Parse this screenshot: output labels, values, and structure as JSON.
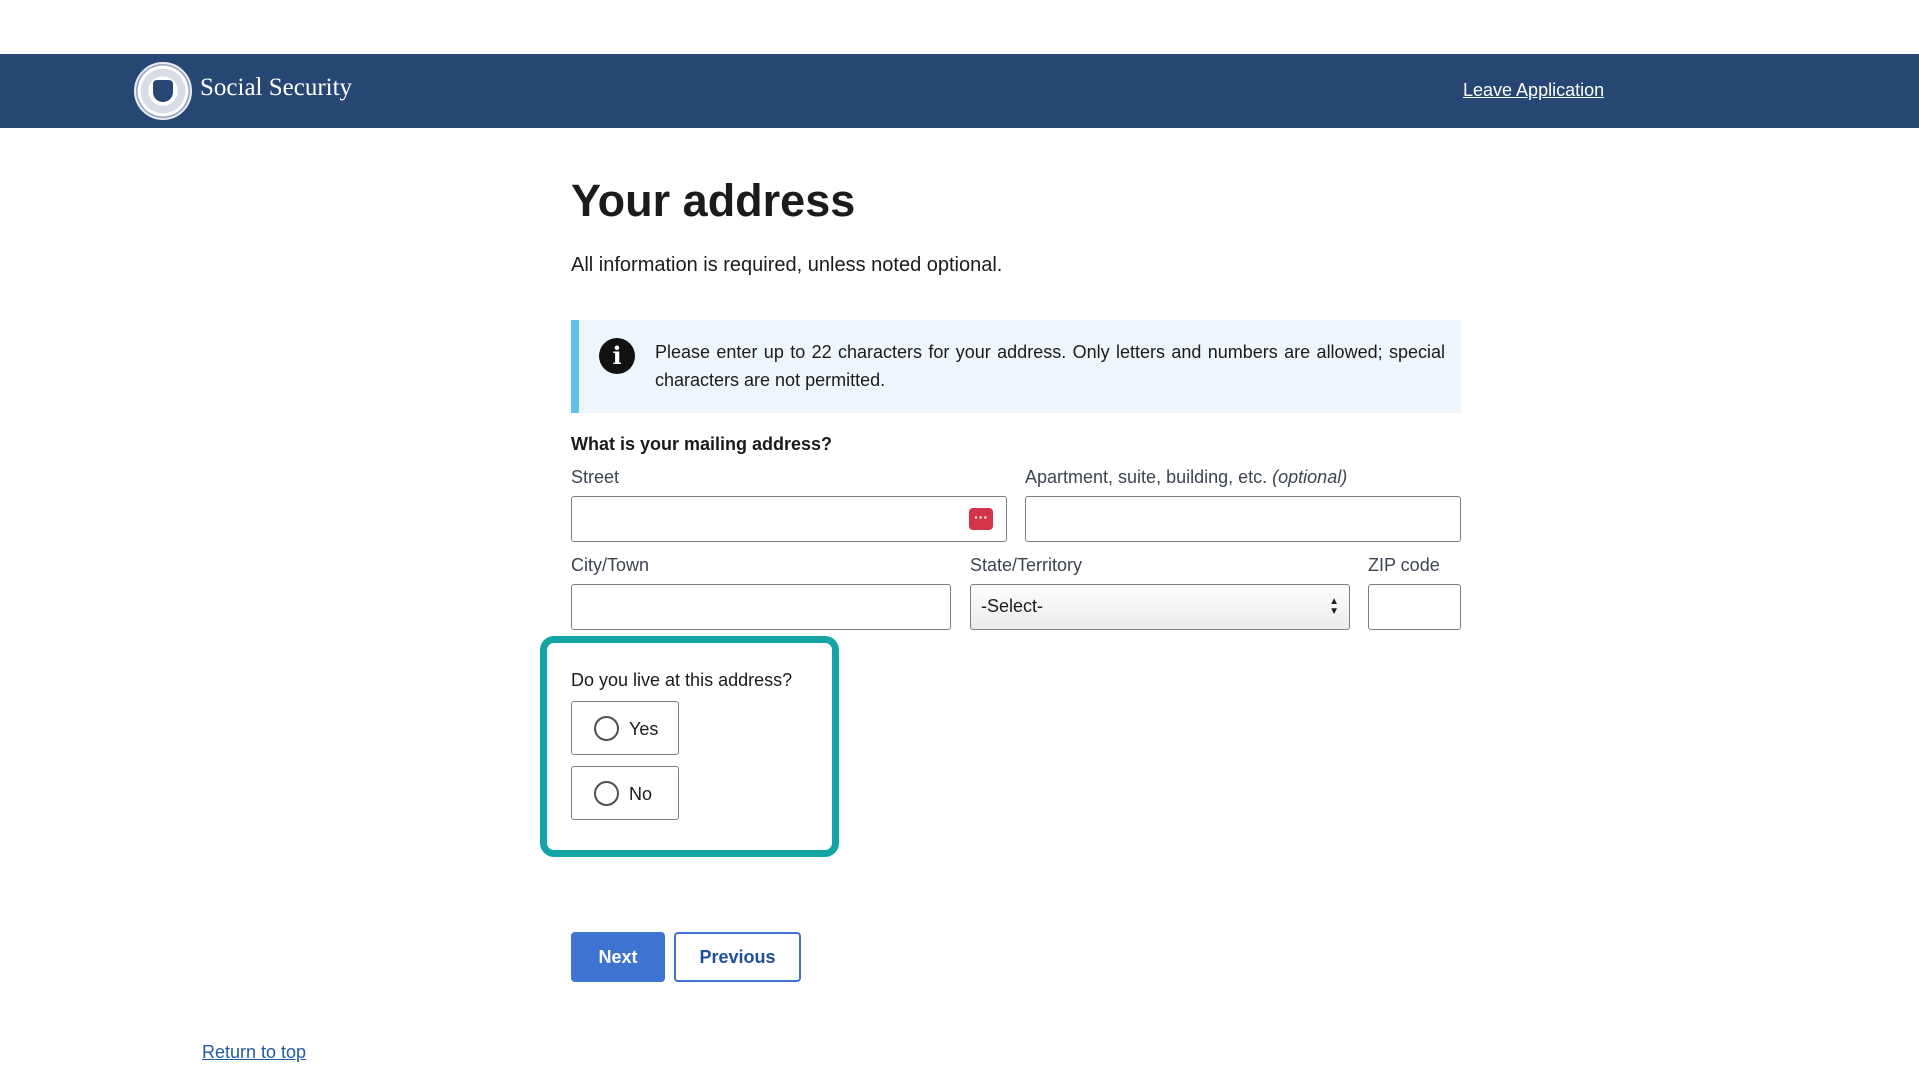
{
  "header": {
    "brand": "Social Security",
    "leave_link": "Leave Application"
  },
  "page": {
    "title": "Your address",
    "intro": "All information is required, unless noted optional."
  },
  "alert": {
    "icon": "info-icon",
    "text": "Please enter up to 22 characters for your address. Only letters and numbers are allowed; special characters are not permitted."
  },
  "form": {
    "question": "What is your mailing address?",
    "street_label": "Street",
    "street_value": "",
    "apartment_label": "Apartment, suite, building, etc.",
    "apartment_optional": "(optional)",
    "apartment_value": "",
    "city_label": "City/Town",
    "city_value": "",
    "state_label": "State/Territory",
    "state_selected": "-Select-",
    "zip_label": "ZIP code",
    "zip_value": ""
  },
  "live_here": {
    "question": "Do you live at this address?",
    "options": [
      "Yes",
      "No"
    ]
  },
  "buttons": {
    "next": "Next",
    "previous": "Previous"
  },
  "footer": {
    "return_to_top": "Return to top"
  },
  "colors": {
    "header_bg": "#264673",
    "alert_accent": "#5fc2e8",
    "focus_highlight": "#14a4a4",
    "primary_button": "#3f73d1"
  }
}
